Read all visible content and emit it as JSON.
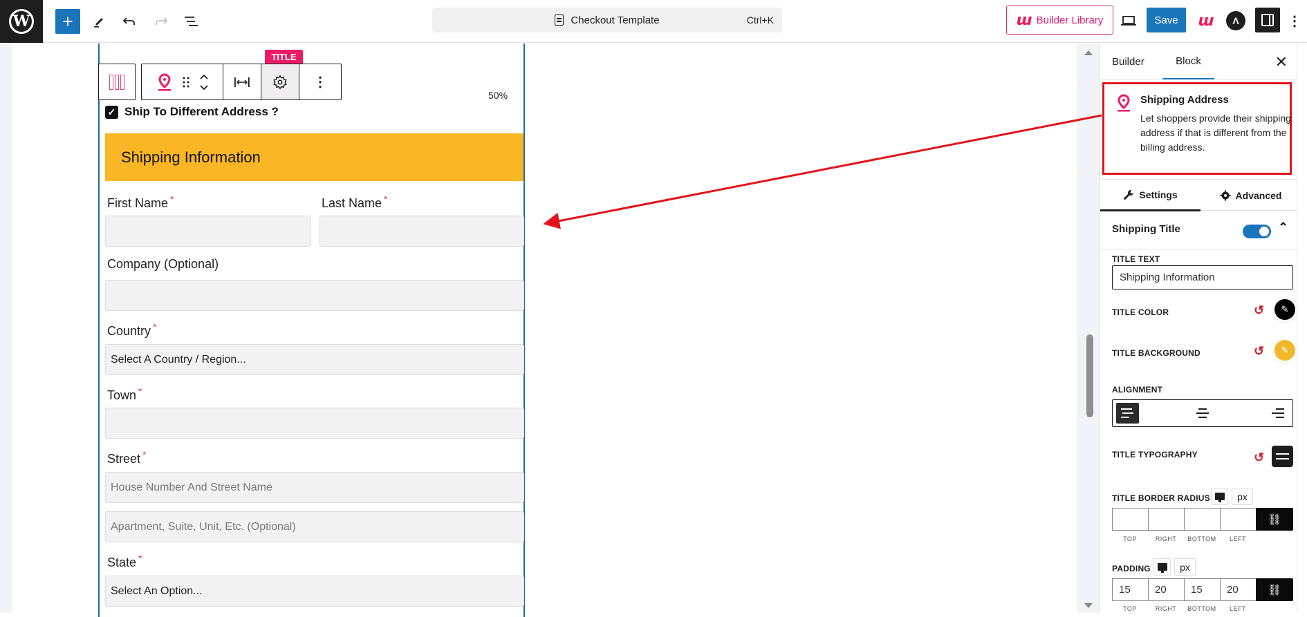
{
  "topbar": {
    "logo": "wordpress-logo",
    "add_label": "+",
    "document_title": "Checkout Template",
    "command_shortcut": "Ctrl+K",
    "builder_library_label": "Builder Library",
    "save_label": "Save"
  },
  "canvas": {
    "toolbar": {
      "badge_label": "TITLE"
    },
    "width_percent": "50%",
    "ship_different": {
      "label": "Ship To Different Address ?",
      "checked": true
    },
    "section_title": "Shipping Information",
    "required_mark": "*",
    "fields": {
      "first_name": {
        "label": "First Name",
        "value": ""
      },
      "last_name": {
        "label": "Last Name",
        "value": ""
      },
      "company": {
        "label": "Company (Optional)",
        "value": ""
      },
      "country": {
        "label": "Country",
        "selected": "Select A Country / Region..."
      },
      "town": {
        "label": "Town",
        "value": ""
      },
      "street": {
        "label": "Street",
        "placeholder_1": "House Number And Street Name",
        "placeholder_2": "Apartment, Suite, Unit, Etc. (Optional)"
      },
      "state": {
        "label": "State",
        "selected": "Select An Option..."
      }
    }
  },
  "sidebar": {
    "tabs": {
      "builder": "Builder",
      "block": "Block",
      "active": "Block"
    },
    "block_card": {
      "name": "Shipping Address",
      "description": "Let shoppers provide their shipping address if that is different from the billing address."
    },
    "settings_tabs": {
      "settings": "Settings",
      "advanced": "Advanced",
      "active": "Settings"
    },
    "panel": {
      "title": "Shipping Title",
      "enabled": true,
      "title_text_label": "TITLE TEXT",
      "title_text_value": "Shipping Information",
      "title_color_label": "TITLE COLOR",
      "title_color": "#000000",
      "title_background_label": "TITLE BACKGROUND",
      "title_background": "#fbb625",
      "alignment_label": "ALIGNMENT",
      "alignment_options": [
        "left",
        "center",
        "right"
      ],
      "alignment_selected": "left",
      "typography_label": "TITLE TYPOGRAPHY",
      "border_radius_label": "TITLE BORDER RADIUS",
      "border_radius_unit": "px",
      "border_radius": {
        "top": "",
        "right": "",
        "bottom": "",
        "left": ""
      },
      "padding_label": "PADDING",
      "padding_unit": "px",
      "padding": {
        "top": "15",
        "right": "20",
        "bottom": "15",
        "left": "20"
      },
      "side_labels": {
        "top": "TOP",
        "right": "RIGHT",
        "bottom": "BOTTOM",
        "left": "LEFT"
      }
    }
  },
  "colors": {
    "wp_blue": "#1b75bb",
    "brand_pink": "#ea1c66",
    "annotation_red": "#e1141c",
    "title_bg": "#fbb625"
  }
}
